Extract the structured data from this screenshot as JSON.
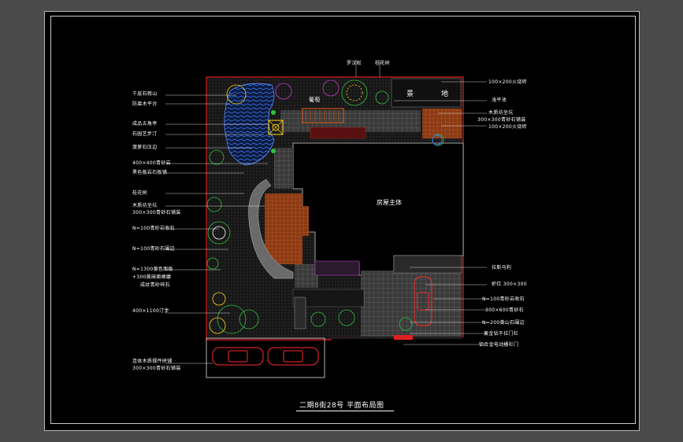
{
  "title": "二期8街28号 平面布局图",
  "center_labels": {
    "house": "房屋主体",
    "pavilion": "景",
    "pavilion2": "地",
    "grape": "葡萄"
  },
  "top_labels": [
    "罗汉松",
    "桂花树"
  ],
  "left_labels": [
    "千层石假山",
    "防腐木平台",
    "成品五角亭",
    "石园艺步汀",
    "菠萝石压边",
    "400×400青砂岩",
    "黑色板岩石板铺",
    "桂花树",
    "木质坊坐坑",
    "300×300青砂石铺装",
    "N=100青砂岩收石",
    "N=100青砂石围边",
    "N=1300黄色面板",
    "+300黄麻面凿磨",
    "成纹青砂碎石",
    "400×1100汀步",
    "连体木质摆件拼铺",
    "300×300青砂石铺装"
  ],
  "right_labels": [
    "100×200火烧砖",
    "浅平池",
    "木质坊坐坑",
    "300×300青砂石铺装",
    "100×200火烧砖",
    "拉斯马利",
    "虾红 300×300",
    "N=100青砂岩收石",
    "300×600青砂石",
    "N=200黄山石围边",
    "黄金钻干拉门栏",
    "铝合金电动栅栏门"
  ],
  "colors": {
    "boundary": "#e02020",
    "water": "#3a6fe0",
    "brick": "#b4501c",
    "paving": "#8a8a8a",
    "plant_green": "#2fbf3a",
    "car": "#ff2a2a",
    "accent_yellow": "#ffd21a",
    "accent_magenta": "#c03cc8"
  }
}
